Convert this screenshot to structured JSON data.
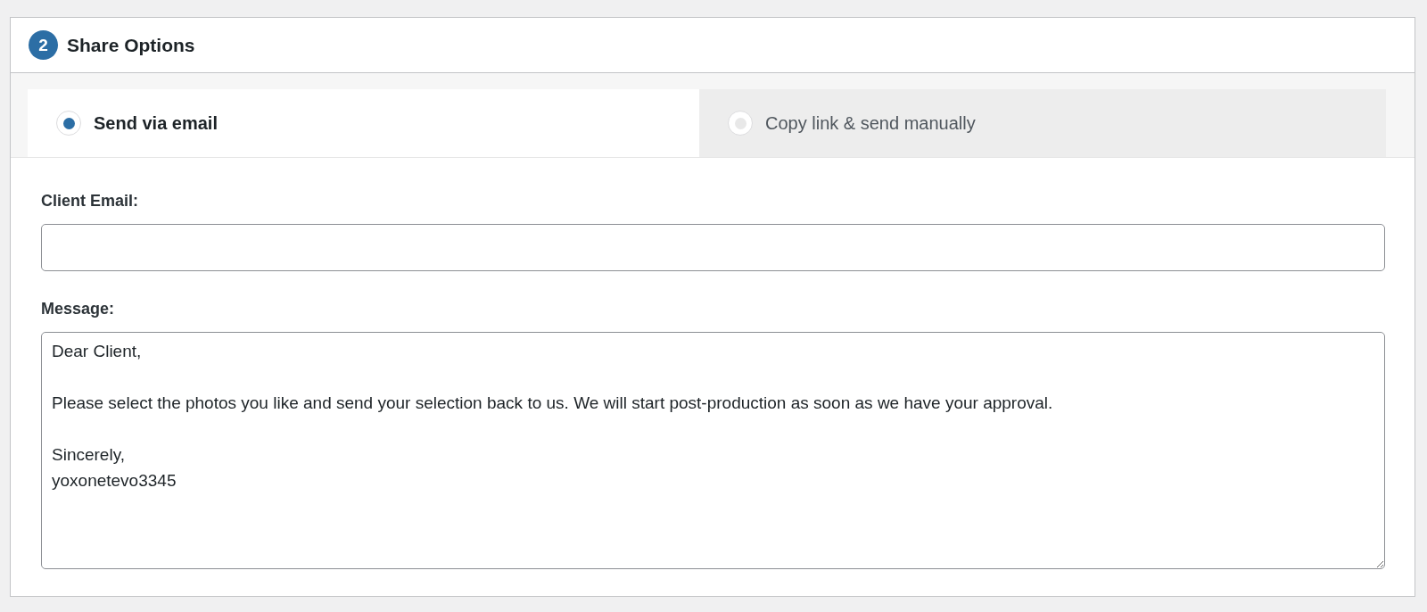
{
  "panel": {
    "step": "2",
    "title": "Share Options"
  },
  "tabs": [
    {
      "label": "Send via email",
      "selected": true
    },
    {
      "label": "Copy link & send manually",
      "selected": false
    }
  ],
  "fields": [
    {
      "label": "Client Email:",
      "kind": "input"
    },
    {
      "label": "Message:",
      "kind": "textarea",
      "value": "Dear Client,\n\nPlease select the photos you like and send your selection back to us. We will start post-production as soon as we have your approval.\n\nSincerely,\nyoxonetevo3345"
    }
  ]
}
